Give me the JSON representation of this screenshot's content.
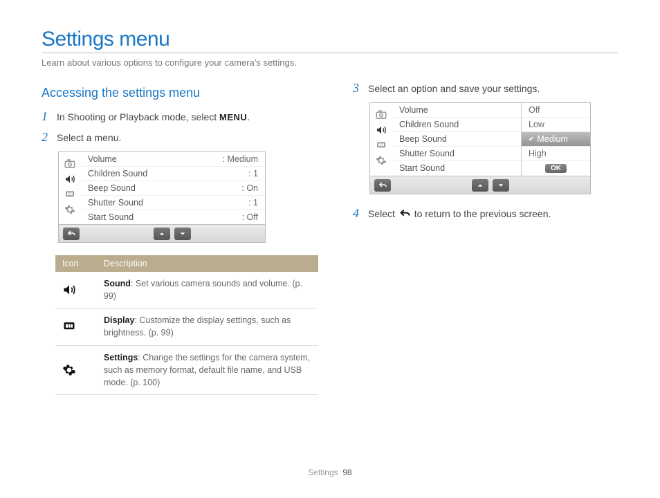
{
  "title": "Settings menu",
  "subtitle": "Learn about various options to configure your camera's settings.",
  "section1": "Accessing the settings menu",
  "steps": {
    "s1a": "In Shooting or Playback mode, select ",
    "s1b": ".",
    "menu_word": "MENU",
    "s2": "Select a menu.",
    "s3": "Select an option and save your settings.",
    "s4a": "Select ",
    "s4b": " to return to the previous screen."
  },
  "camera1": {
    "rows": [
      {
        "label": "Volume",
        "val": ": Medium"
      },
      {
        "label": "Children Sound",
        "val": ": 1"
      },
      {
        "label": "Beep Sound",
        "val": ": On"
      },
      {
        "label": "Shutter Sound",
        "val": ": 1"
      },
      {
        "label": "Start Sound",
        "val": ": Off"
      }
    ]
  },
  "camera2": {
    "labels": [
      "Volume",
      "Children Sound",
      "Beep Sound",
      "Shutter Sound",
      "Start Sound"
    ],
    "options": [
      "Off",
      "Low",
      "Medium",
      "High"
    ],
    "ok": "OK"
  },
  "table": {
    "h1": "Icon",
    "h2": "Description",
    "rows": [
      {
        "bold": "Sound",
        "rest": ": Set various camera sounds and volume. (p. 99)"
      },
      {
        "bold": "Display",
        "rest": ": Customize the display settings, such as brightness. (p. 99)"
      },
      {
        "bold": "Settings",
        "rest": ": Change the settings for the camera system, such as memory format, default file name, and USB mode. (p. 100)"
      }
    ]
  },
  "footer": {
    "section": "Settings",
    "page": "98"
  }
}
